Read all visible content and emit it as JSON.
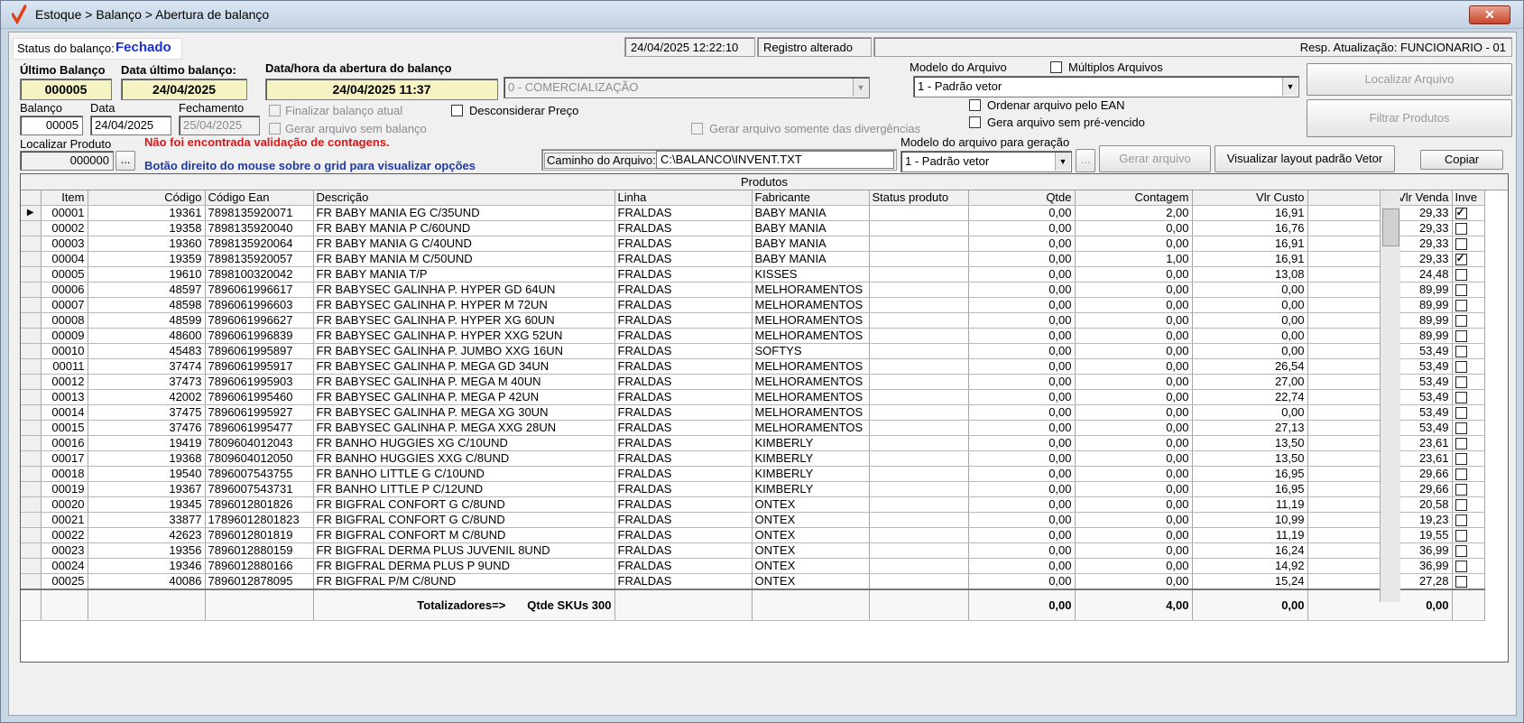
{
  "window": {
    "title": "Estoque > Balanço > Abertura de balanço",
    "close_symbol": "✕"
  },
  "status": {
    "label": "Status do balanço:",
    "value": "Fechado",
    "datetime": "24/04/2025 12:22:10",
    "registro": "Registro alterado",
    "resp": "Resp. Atualização: FUNCIONARIO - 01"
  },
  "header": {
    "ultimo_balanco_label": "Último Balanço",
    "ultimo_balanco": "000005",
    "data_ultimo_label": "Data último balanço:",
    "data_ultimo": "24/04/2025",
    "abertura_label": "Data/hora da abertura do balanço",
    "abertura": "24/04/2025 11:37",
    "comercializacao": "0 - COMERCIALIZAÇÃO",
    "modelo_arquivo_label": "Modelo do Arquivo",
    "multiplos_label": "Múltiplos Arquivos",
    "modelo_arquivo": "1 - Padrão vetor",
    "localizar_arquivo": "Localizar Arquivo",
    "filtrar_produtos": "Filtrar Produtos"
  },
  "form": {
    "balanco_label": "Balanço",
    "balanco": "00005",
    "data_label": "Data",
    "data": "24/04/2025",
    "fechamento_label": "Fechamento",
    "fechamento": "25/04/2025",
    "finalizar_label": "Finalizar balanço atual",
    "gerar_sem_label": "Gerar arquivo sem balanço",
    "desconsiderar_label": "Desconsiderar Preço",
    "divergencias_label": "Gerar arquivo somente das divergências",
    "ordenar_ean_label": "Ordenar arquivo pelo EAN",
    "pre_vencido_label": "Gera arquivo sem pré-vencido",
    "localizar_produto_label": "Localizar Produto",
    "localizar_produto": "000000",
    "ellipsis": "...",
    "msg_erro": "Não foi encontrada validação de contagens.",
    "msg_info": "Botão direito do mouse sobre o grid para visualizar opções",
    "caminho_label": "Caminho do Arquivo:",
    "caminho": "C:\\BALANCO\\INVENT.TXT",
    "modelo_geracao_label": "Modelo do arquivo para geração",
    "modelo_geracao": "1 - Padrão vetor",
    "gerar_arquivo": "Gerar arquivo",
    "visualizar_layout": "Visualizar layout padrão Vetor",
    "copiar": "Copiar"
  },
  "grid": {
    "title": "Produtos",
    "columns": [
      "Item",
      "Código",
      "Código Ean",
      "Descrição",
      "Linha",
      "Fabricante",
      "Status produto",
      "Qtde",
      "Contagem",
      "Vlr Custo",
      "Vlr Venda",
      "Inve"
    ],
    "current_row_marker": "▶",
    "rows": [
      {
        "item": "00001",
        "codigo": "19361",
        "ean": "7898135920071",
        "descricao": "FR BABY MANIA  EG C/35UND",
        "linha": "FRALDAS",
        "fabricante": "BABY MANIA",
        "status": "",
        "qtde": "0,00",
        "contagem": "2,00",
        "custo": "16,91",
        "venda": "29,33",
        "inv": true
      },
      {
        "item": "00002",
        "codigo": "19358",
        "ean": "7898135920040",
        "descricao": "FR BABY MANIA  P C/60UND",
        "linha": "FRALDAS",
        "fabricante": "BABY MANIA",
        "status": "",
        "qtde": "0,00",
        "contagem": "0,00",
        "custo": "16,76",
        "venda": "29,33",
        "inv": false
      },
      {
        "item": "00003",
        "codigo": "19360",
        "ean": "7898135920064",
        "descricao": "FR BABY MANIA G C/40UND",
        "linha": "FRALDAS",
        "fabricante": "BABY MANIA",
        "status": "",
        "qtde": "0,00",
        "contagem": "0,00",
        "custo": "16,91",
        "venda": "29,33",
        "inv": false
      },
      {
        "item": "00004",
        "codigo": "19359",
        "ean": "7898135920057",
        "descricao": "FR BABY MANIA M C/50UND",
        "linha": "FRALDAS",
        "fabricante": "BABY MANIA",
        "status": "",
        "qtde": "0,00",
        "contagem": "1,00",
        "custo": "16,91",
        "venda": "29,33",
        "inv": true
      },
      {
        "item": "00005",
        "codigo": "19610",
        "ean": "7898100320042",
        "descricao": "FR BABY MANIA T/P",
        "linha": "FRALDAS",
        "fabricante": "KISSES",
        "status": "",
        "qtde": "0,00",
        "contagem": "0,00",
        "custo": "13,08",
        "venda": "24,48",
        "inv": false
      },
      {
        "item": "00006",
        "codigo": "48597",
        "ean": "7896061996617",
        "descricao": "FR BABYSEC GALINHA P. HYPER GD 64UN",
        "linha": "FRALDAS",
        "fabricante": "MELHORAMENTOS",
        "status": "",
        "qtde": "0,00",
        "contagem": "0,00",
        "custo": "0,00",
        "venda": "89,99",
        "inv": false
      },
      {
        "item": "00007",
        "codigo": "48598",
        "ean": "7896061996603",
        "descricao": "FR BABYSEC GALINHA P. HYPER M 72UN",
        "linha": "FRALDAS",
        "fabricante": "MELHORAMENTOS",
        "status": "",
        "qtde": "0,00",
        "contagem": "0,00",
        "custo": "0,00",
        "venda": "89,99",
        "inv": false
      },
      {
        "item": "00008",
        "codigo": "48599",
        "ean": "7896061996627",
        "descricao": "FR BABYSEC GALINHA P. HYPER XG 60UN",
        "linha": "FRALDAS",
        "fabricante": "MELHORAMENTOS",
        "status": "",
        "qtde": "0,00",
        "contagem": "0,00",
        "custo": "0,00",
        "venda": "89,99",
        "inv": false
      },
      {
        "item": "00009",
        "codigo": "48600",
        "ean": "7896061996839",
        "descricao": "FR BABYSEC GALINHA P. HYPER XXG 52UN",
        "linha": "FRALDAS",
        "fabricante": "MELHORAMENTOS",
        "status": "",
        "qtde": "0,00",
        "contagem": "0,00",
        "custo": "0,00",
        "venda": "89,99",
        "inv": false
      },
      {
        "item": "00010",
        "codigo": "45483",
        "ean": "7896061995897",
        "descricao": "FR BABYSEC GALINHA P. JUMBO XXG 16UN",
        "linha": "FRALDAS",
        "fabricante": "SOFTYS",
        "status": "",
        "qtde": "0,00",
        "contagem": "0,00",
        "custo": "0,00",
        "venda": "53,49",
        "inv": false
      },
      {
        "item": "00011",
        "codigo": "37474",
        "ean": "7896061995917",
        "descricao": "FR BABYSEC GALINHA P. MEGA GD 34UN",
        "linha": "FRALDAS",
        "fabricante": "MELHORAMENTOS",
        "status": "",
        "qtde": "0,00",
        "contagem": "0,00",
        "custo": "26,54",
        "venda": "53,49",
        "inv": false
      },
      {
        "item": "00012",
        "codigo": "37473",
        "ean": "7896061995903",
        "descricao": "FR BABYSEC GALINHA P. MEGA M 40UN",
        "linha": "FRALDAS",
        "fabricante": "MELHORAMENTOS",
        "status": "",
        "qtde": "0,00",
        "contagem": "0,00",
        "custo": "27,00",
        "venda": "53,49",
        "inv": false
      },
      {
        "item": "00013",
        "codigo": "42002",
        "ean": "7896061995460",
        "descricao": "FR BABYSEC GALINHA P. MEGA P 42UN",
        "linha": "FRALDAS",
        "fabricante": "MELHORAMENTOS",
        "status": "",
        "qtde": "0,00",
        "contagem": "0,00",
        "custo": "22,74",
        "venda": "53,49",
        "inv": false
      },
      {
        "item": "00014",
        "codigo": "37475",
        "ean": "7896061995927",
        "descricao": "FR BABYSEC GALINHA P. MEGA XG 30UN",
        "linha": "FRALDAS",
        "fabricante": "MELHORAMENTOS",
        "status": "",
        "qtde": "0,00",
        "contagem": "0,00",
        "custo": "0,00",
        "venda": "53,49",
        "inv": false
      },
      {
        "item": "00015",
        "codigo": "37476",
        "ean": "7896061995477",
        "descricao": "FR BABYSEC GALINHA P. MEGA XXG 28UN",
        "linha": "FRALDAS",
        "fabricante": "MELHORAMENTOS",
        "status": "",
        "qtde": "0,00",
        "contagem": "0,00",
        "custo": "27,13",
        "venda": "53,49",
        "inv": false
      },
      {
        "item": "00016",
        "codigo": "19419",
        "ean": "7809604012043",
        "descricao": "FR BANHO HUGGIES XG C/10UND",
        "linha": "FRALDAS",
        "fabricante": "KIMBERLY",
        "status": "",
        "qtde": "0,00",
        "contagem": "0,00",
        "custo": "13,50",
        "venda": "23,61",
        "inv": false
      },
      {
        "item": "00017",
        "codigo": "19368",
        "ean": "7809604012050",
        "descricao": "FR BANHO HUGGIES XXG C/8UND",
        "linha": "FRALDAS",
        "fabricante": "KIMBERLY",
        "status": "",
        "qtde": "0,00",
        "contagem": "0,00",
        "custo": "13,50",
        "venda": "23,61",
        "inv": false
      },
      {
        "item": "00018",
        "codigo": "19540",
        "ean": "7896007543755",
        "descricao": "FR BANHO LITTLE G C/10UND",
        "linha": "FRALDAS",
        "fabricante": "KIMBERLY",
        "status": "",
        "qtde": "0,00",
        "contagem": "0,00",
        "custo": "16,95",
        "venda": "29,66",
        "inv": false
      },
      {
        "item": "00019",
        "codigo": "19367",
        "ean": "7896007543731",
        "descricao": "FR BANHO LITTLE P C/12UND",
        "linha": "FRALDAS",
        "fabricante": "KIMBERLY",
        "status": "",
        "qtde": "0,00",
        "contagem": "0,00",
        "custo": "16,95",
        "venda": "29,66",
        "inv": false
      },
      {
        "item": "00020",
        "codigo": "19345",
        "ean": "7896012801826",
        "descricao": "FR BIGFRAL CONFORT G C/8UND",
        "linha": "FRALDAS",
        "fabricante": "ONTEX",
        "status": "",
        "qtde": "0,00",
        "contagem": "0,00",
        "custo": "11,19",
        "venda": "20,58",
        "inv": false
      },
      {
        "item": "00021",
        "codigo": "33877",
        "ean": "17896012801823",
        "descricao": "FR BIGFRAL CONFORT G C/8UND",
        "linha": "FRALDAS",
        "fabricante": "ONTEX",
        "status": "",
        "qtde": "0,00",
        "contagem": "0,00",
        "custo": "10,99",
        "venda": "19,23",
        "inv": false
      },
      {
        "item": "00022",
        "codigo": "42623",
        "ean": "7896012801819",
        "descricao": "FR BIGFRAL CONFORT M C/8UND",
        "linha": "FRALDAS",
        "fabricante": "ONTEX",
        "status": "",
        "qtde": "0,00",
        "contagem": "0,00",
        "custo": "11,19",
        "venda": "19,55",
        "inv": false
      },
      {
        "item": "00023",
        "codigo": "19356",
        "ean": "7896012880159",
        "descricao": "FR BIGFRAL DERMA PLUS JUVENIL 8UND",
        "linha": "FRALDAS",
        "fabricante": "ONTEX",
        "status": "",
        "qtde": "0,00",
        "contagem": "0,00",
        "custo": "16,24",
        "venda": "36,99",
        "inv": false
      },
      {
        "item": "00024",
        "codigo": "19346",
        "ean": "7896012880166",
        "descricao": "FR BIGFRAL DERMA PLUS P 9UND",
        "linha": "FRALDAS",
        "fabricante": "ONTEX",
        "status": "",
        "qtde": "0,00",
        "contagem": "0,00",
        "custo": "14,92",
        "venda": "36,99",
        "inv": false
      },
      {
        "item": "00025",
        "codigo": "40086",
        "ean": "7896012878095",
        "descricao": "FR BIGFRAL P/M C/8UND",
        "linha": "FRALDAS",
        "fabricante": "ONTEX",
        "status": "",
        "qtde": "0,00",
        "contagem": "0,00",
        "custo": "15,24",
        "venda": "27,28",
        "inv": false
      }
    ],
    "totals": {
      "label": "Totalizadores=>",
      "skus": "Qtde SKUs 300",
      "qtde": "0,00",
      "contagem": "4,00",
      "custo": "0,00",
      "venda": "0,00"
    }
  }
}
